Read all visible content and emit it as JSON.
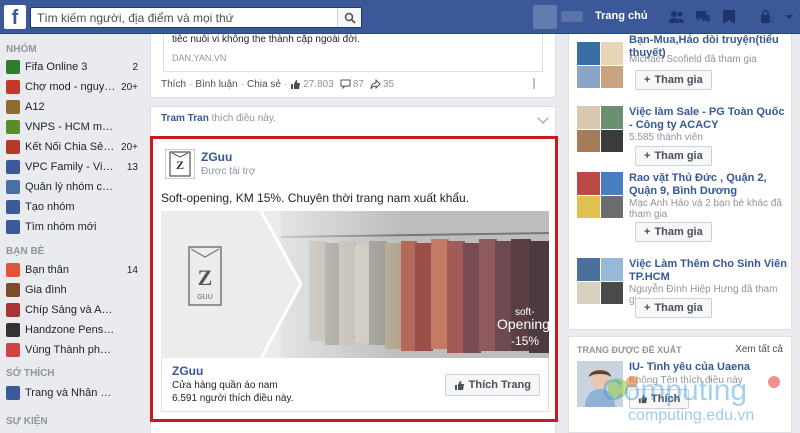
{
  "topbar": {
    "logo": "f",
    "search_placeholder": "Tìm kiếm người, địa điểm và mọi thứ",
    "home_label": "Trang chủ"
  },
  "leftnav": {
    "groups_header": "NHÓM",
    "groups": [
      {
        "label": "Fifa Online 3",
        "count": "2",
        "color": "#2d7d2d"
      },
      {
        "label": "Chợ mod - nguyên...",
        "count": "20+",
        "color": "#c0392b"
      },
      {
        "label": "A12",
        "count": "",
        "color": "#8e6b2e"
      },
      {
        "label": "VNPS - HCM mem...",
        "count": "",
        "color": "#5b8c2a"
      },
      {
        "label": "Kết Nối Chia Sẻ Ni...",
        "count": "20+",
        "color": "#b23a2a"
      },
      {
        "label": "VPC Family - Vietn...",
        "count": "13",
        "color": "#3b5998"
      },
      {
        "label": "Quản lý nhóm của ...",
        "count": "",
        "color": "#4a6fa5"
      },
      {
        "label": "Tạo nhóm",
        "count": "",
        "color": "#3b5998"
      },
      {
        "label": "Tìm nhóm mới",
        "count": "",
        "color": "#3b5998"
      }
    ],
    "friends_header": "BẠN BÈ",
    "friends": [
      {
        "label": "Bạn thân",
        "count": "14",
        "color": "#e0553a"
      },
      {
        "label": "Gia đình",
        "count": "",
        "color": "#7a4d2b"
      },
      {
        "label": "Chíp Sảng và Ash...",
        "count": "",
        "color": "#a33"
      },
      {
        "label": "Handzone Penshop",
        "count": "",
        "color": "#333"
      },
      {
        "label": "Vùng Thành phố Hồ...",
        "count": "",
        "color": "#c44"
      }
    ],
    "interests_header": "SỞ THÍCH",
    "interests": [
      {
        "label": "Trang và Nhân vật ...",
        "count": "",
        "color": "#3b5998"
      }
    ],
    "events_header": "SỰ KIỆN"
  },
  "post_top": {
    "share_title": "tiêc nuôi vi không the thành cặp ngoài đời.",
    "share_domain": "DAN.YAN.VN",
    "like": "Thích",
    "comment": "Bình luận",
    "share": "Chia sẻ",
    "likes_count": "27.803",
    "comments_count": "87",
    "shares_count": "35"
  },
  "liked_row": {
    "name": "Tram Tran",
    "text": " thích điều này."
  },
  "ad": {
    "page_name": "ZGuu",
    "sponsored": "Được tài trợ",
    "text": "Soft-opening, KM 15%. Chuyên thời trang nam xuất khẩu.",
    "logo_letter": "Z",
    "logo_sub": "GUU",
    "image_text_1": "soft-",
    "image_text_2": "Opening",
    "image_text_3": "-15%",
    "footer_name": "ZGuu",
    "footer_category": "Cửa hàng quần áo nam",
    "footer_likes": "6.591 người thích điều này.",
    "like_button": "Thích Trang"
  },
  "right": {
    "groups": [
      {
        "title": "Bạn-Mua,Hảo dòi truyện(tiểu thuyết)",
        "meta": "Michael Scofield đã tham gia",
        "join": "Tham gia"
      },
      {
        "title": "Việc làm Sale - PG Toàn Quốc - Công ty ACACY",
        "meta": "5.585 thành viên",
        "join": "Tham gia"
      },
      {
        "title": "Rao vặt Thủ Đức , Quận 2, Quận 9, Bình Dương",
        "meta": "Mạc Anh Hảo và 2 bạn bè khác đã tham gia",
        "join": "Tham gia"
      },
      {
        "title": "Việc Làm Thêm Cho Sinh Viên TP.HCM",
        "meta": "Nguyễn Đình Hiệp Hưng đã tham gia",
        "join": "Tham gia"
      }
    ],
    "suggested_header": "TRANG ĐƯỢC ĐỀ XUẤT",
    "see_all": "Xem tất cả",
    "suggested_title": "IU- Tình yêu của Uaena",
    "suggested_meta": "Không Tên thích điều này",
    "suggested_like": "Thích"
  },
  "watermark": {
    "main": "Computing",
    "url": "computing.edu.vn"
  }
}
